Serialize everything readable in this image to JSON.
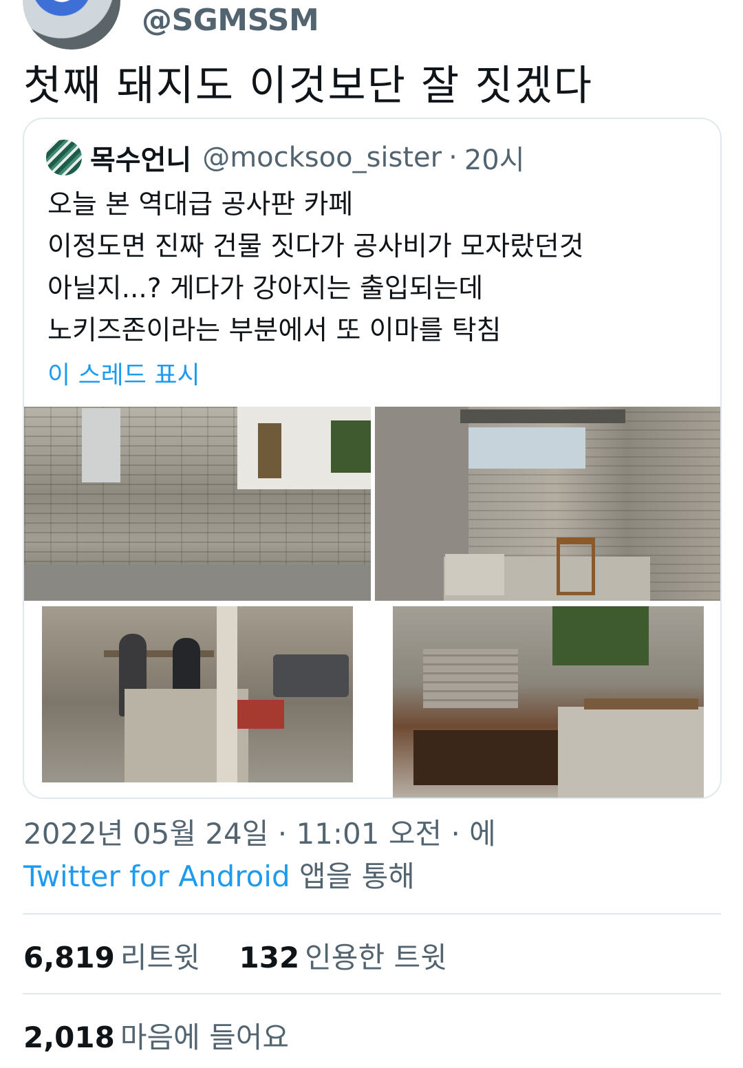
{
  "tweet": {
    "handle": "@SGMSSM",
    "text": "첫째 돼지도 이것보단 잘 짓겠다",
    "date_line": "2022년 05월 24일 · 11:01 오전 · 에",
    "app_link": "Twitter for Android",
    "app_suffix": " 앱을 통해"
  },
  "quote": {
    "name": "목수언니",
    "handle": "@mocksoo_sister",
    "separator": "·",
    "time": "20시",
    "lines": [
      "오늘 본 역대급 공사판 카페",
      "이정도면 진짜 건물 짓다가 공사비가 모자랐던것",
      "아닐지...? 게다가 강아지는 출입되는데",
      "노키즈존이라는 부분에서 또 이마를 탁침"
    ],
    "show_thread": "이 스레드 표시"
  },
  "stats": {
    "retweets_count": "6,819",
    "retweets_label": "리트윗",
    "quotes_count": "132",
    "quotes_label": "인용한 트윗",
    "likes_count": "2,018",
    "likes_label": "마음에 들어요"
  },
  "colors": {
    "link": "#1d9bf0",
    "secondary_text": "#536471",
    "border": "#e1e8ed"
  }
}
